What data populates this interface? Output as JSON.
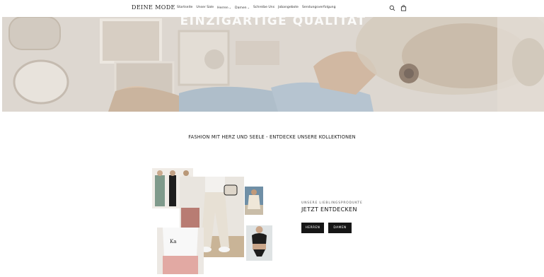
{
  "header": {
    "logo": "DEINE MODE",
    "nav": [
      {
        "label": "Startseite"
      },
      {
        "label": "Unser Sale"
      },
      {
        "label": "Herren",
        "dropdown": true
      },
      {
        "label": "Damen",
        "dropdown": true
      },
      {
        "label": "Schreibe Uns"
      },
      {
        "label": "Jobangebote"
      },
      {
        "label": "Sendungsverfolgung"
      }
    ],
    "icons": [
      "search-icon",
      "shopping-bag-icon"
    ]
  },
  "hero": {
    "title": "EINZIGARTIGE QUALITÄT"
  },
  "tagline": "FASHION MIT HERZ UND SEELE - ENTDECKE UNSERE KOLLEKTIONEN",
  "promo": {
    "subtitle": "UNSERE LIEBLINGSPRODUKTE",
    "title": "JETZT ENTDECKEN",
    "button_men": "HERREN",
    "button_women": "DAMEN"
  },
  "colors": {
    "button_bg": "#161616",
    "button_text": "#ffffff"
  }
}
